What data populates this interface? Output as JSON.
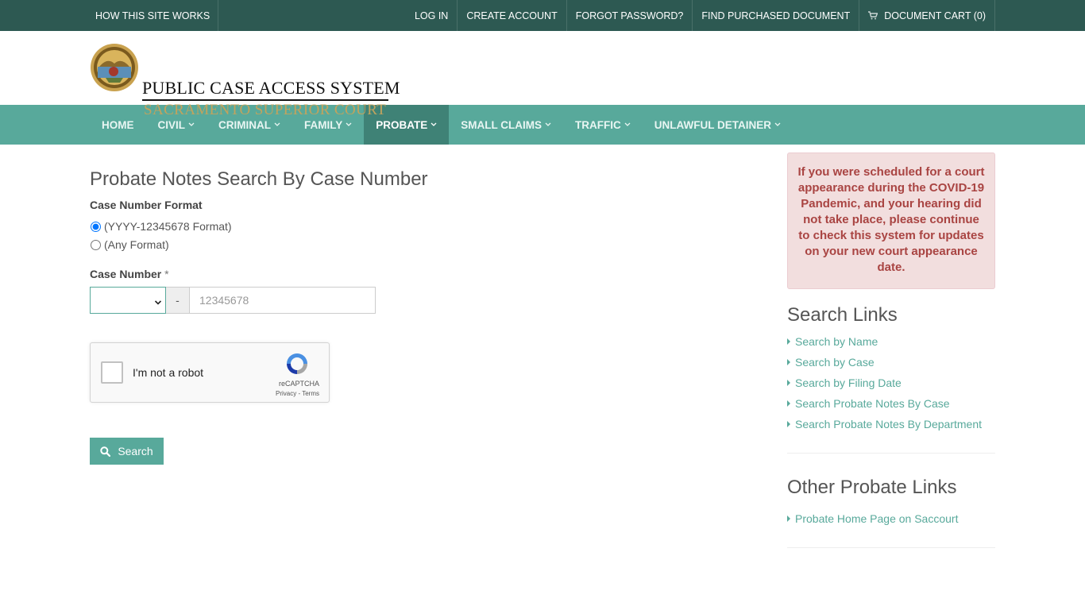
{
  "topbar": {
    "how_it_works": "HOW THIS SITE WORKS",
    "log_in": "LOG IN",
    "create_account": "CREATE ACCOUNT",
    "forgot_password": "FORGOT PASSWORD?",
    "find_purchased": "FIND PURCHASED DOCUMENT",
    "cart": "DOCUMENT CART (0)"
  },
  "brand": {
    "title": "PUBLIC CASE ACCESS SYSTEM",
    "subtitle": "SACRAMENTO SUPERIOR COURT"
  },
  "nav": {
    "home": "HOME",
    "civil": "CIVIL",
    "criminal": "CRIMINAL",
    "family": "FAMILY",
    "probate": "PROBATE",
    "small_claims": "SMALL CLAIMS",
    "traffic": "TRAFFIC",
    "unlawful_detainer": "UNLAWFUL DETAINER"
  },
  "form": {
    "title": "Probate Notes Search By Case Number",
    "format_label": "Case Number Format",
    "format_option_1": "(YYYY-12345678 Format)",
    "format_option_2": "(Any Format)",
    "case_number_label": "Case Number",
    "required_mark": "*",
    "dash": "-",
    "case_placeholder": "12345678",
    "search_label": "Search"
  },
  "captcha": {
    "label": "I'm not a robot",
    "brand": "reCAPTCHA",
    "links": "Privacy - Terms"
  },
  "sidebar": {
    "alert": "If you were scheduled for a court appearance during the COVID-19 Pandemic, and your hearing did not take place, please continue to check this system for updates on your new court appearance date.",
    "search_links_title": "Search Links",
    "search_links": [
      "Search by Name",
      "Search by Case",
      "Search by Filing Date",
      "Search Probate Notes By Case",
      "Search Probate Notes By Department"
    ],
    "other_links_title": "Other Probate Links",
    "other_links": [
      "Probate Home Page on Saccourt"
    ]
  },
  "colors": {
    "topbar": "#2d5952",
    "nav": "#58a99b",
    "nav_active": "#3f8276",
    "accent": "#58a99b",
    "brand_gold": "#c2a35d",
    "alert_bg": "#f2dede",
    "alert_text": "#a94442"
  },
  "icons": {
    "cart": "shopping-cart-icon",
    "chevron": "chevron-down-icon",
    "search": "search-icon",
    "seal": "court-seal-icon",
    "recaptcha": "recaptcha-logo-icon"
  }
}
